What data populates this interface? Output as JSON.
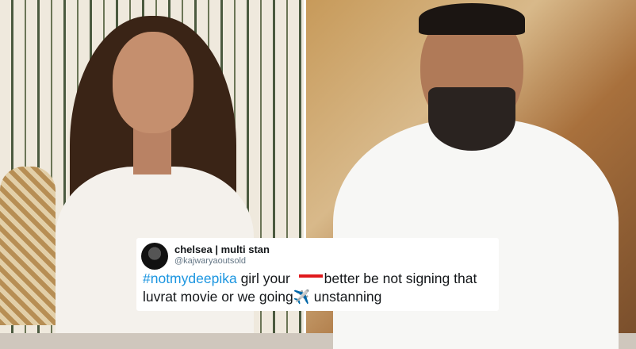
{
  "tweet": {
    "display_name": "chelsea | multi stan",
    "handle": "@kajwaryaoutsold",
    "hashtag": "#notmydeepika",
    "text_part1": " girl your ",
    "text_part2": "better be not signing that luvrat movie or we going",
    "emoji": "✈️",
    "text_part3": " unstanning"
  },
  "colors": {
    "hashtag": "#1b95e0",
    "redaction": "#e0191c",
    "card_bg": "#ffffff"
  }
}
